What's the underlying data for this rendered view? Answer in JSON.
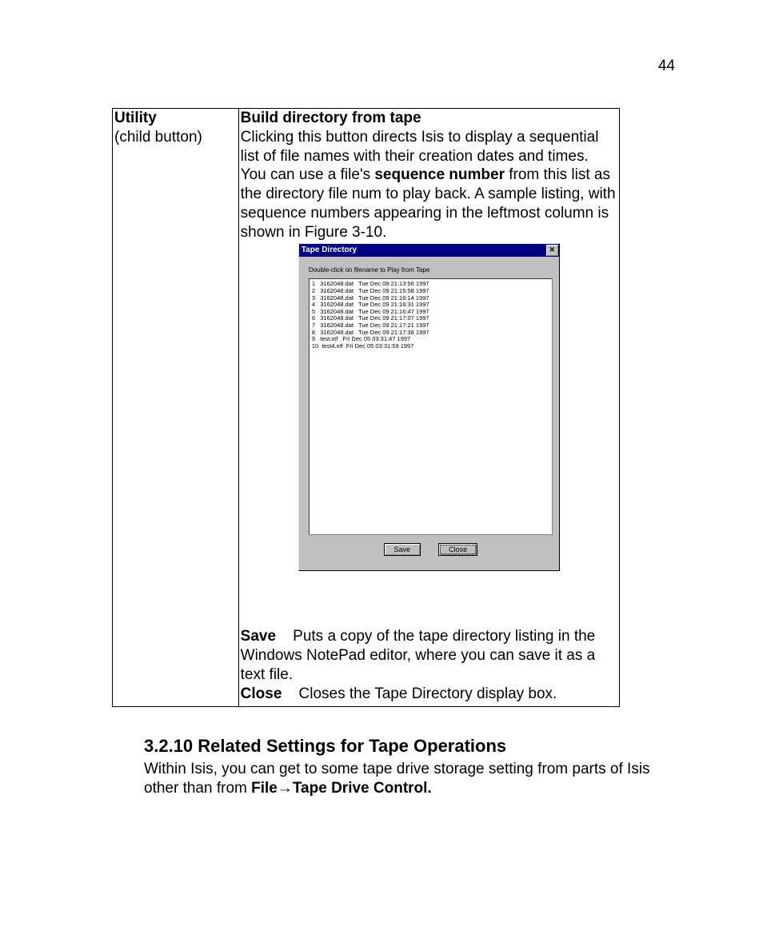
{
  "page_number": "44",
  "table": {
    "left_heading": "Utility",
    "left_sub": "(child button)",
    "right_heading": "Build directory from tape",
    "intro_1": "Clicking this button directs Isis to display a sequential list of file names with their creation dates and times. You can use a file's ",
    "intro_bold": "sequence number",
    "intro_2": " from this list as the directory file num to play back. A sample listing, with sequence numbers appearing in the leftmost column is shown in Figure 3-10.",
    "save_label": "Save",
    "save_desc": "Puts a copy of the tape directory listing in the Windows NotePad editor, where you can save it as a text file.",
    "close_label": "Close",
    "close_desc": "Closes the Tape Directory display box."
  },
  "dialog": {
    "title": "Tape Directory",
    "instruction": "Double-click on filename to Play from Tape",
    "rows": [
      "1   3162048.dat   Tue Dec 09 21:13:56 1997",
      "2   3162048.dat   Tue Dec 09 21:15:58 1997",
      "3   3162048.dat   Tue Dec 09 21:16:14 1997",
      "4   3162048.dat   Tue Dec 09 21:16:31 1997",
      "5   3162048.dat   Tue Dec 09 21:16:47 1997",
      "6   3162048.dat   Tue Dec 09 21:17:07 1997",
      "7   3162048.dat   Tue Dec 09 21:17:21 1997",
      "8   3162048.dat   Tue Dec 09 21:17:38 1997",
      "9   test.xtf   Fri Dec 05 03:31:47 1997",
      "10  test4.xtf  Fri Dec 05 03:31:59 1997"
    ],
    "btn_save": "Save",
    "btn_close": "Close"
  },
  "section": {
    "heading": "3.2.10 Related Settings for Tape Operations",
    "body_1": "Within Isis, you can get to some tape drive storage setting from parts of Isis other than from ",
    "body_bold_file": "File",
    "body_arrow": "→",
    "body_bold_tdc": "Tape Drive Control."
  }
}
